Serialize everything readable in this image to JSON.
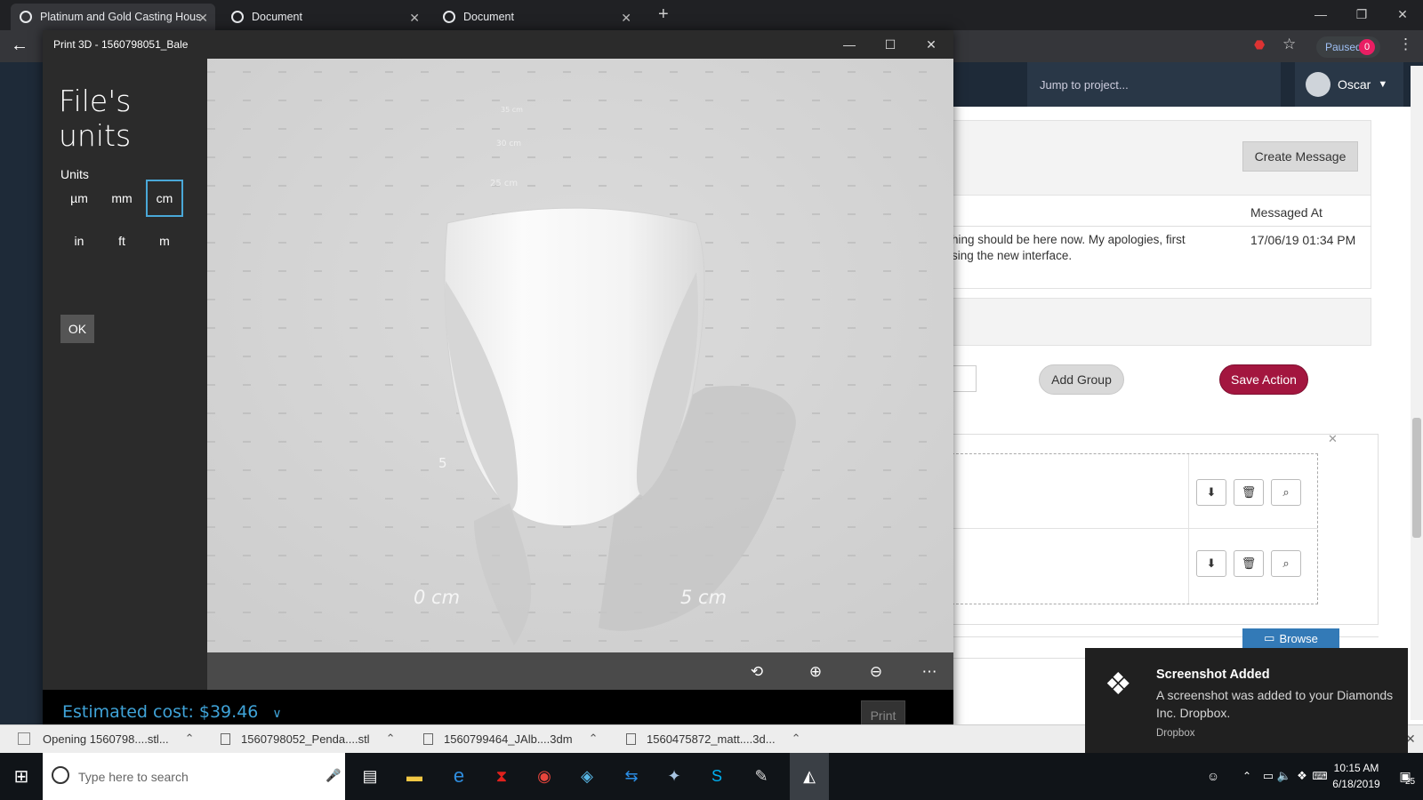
{
  "browser": {
    "tabs": [
      {
        "label": "Platinum and Gold Casting House",
        "active": true
      },
      {
        "label": "Document",
        "active": false
      },
      {
        "label": "Document",
        "active": false
      }
    ],
    "new_tab": "+",
    "paused_label": "Paused",
    "paused_count": "0"
  },
  "webpage": {
    "jump_placeholder": "Jump to project...",
    "user_name": "Oscar",
    "create_message": "Create Message",
    "messaged_at_header": "Messaged At",
    "message_text_line1": "hing should be here now. My apologies, first",
    "message_text_line2": "sing the new interface.",
    "message_time": "17/06/19 01:34 PM",
    "add_group": "Add Group",
    "save_action": "Save Action",
    "browse": "Browse"
  },
  "print3d": {
    "title": "Print 3D - 1560798051_Bale",
    "heading": "File's units",
    "units_label": "Units",
    "units": [
      "µm",
      "mm",
      "cm",
      "in",
      "ft",
      "m"
    ],
    "selected_unit": "cm",
    "ok": "OK",
    "ruler": {
      "vertical": [
        "35 cm",
        "30 cm",
        "25 cm"
      ],
      "side": "5",
      "bottom": [
        "0 cm",
        "5 cm"
      ]
    },
    "estimated_cost": "Estimated cost: $39.46",
    "print": "Print"
  },
  "downloads": [
    "Opening 1560798....stl...",
    "1560798052_Penda....stl",
    "1560799464_JAlb....3dm",
    "1560475872_matt....3d..."
  ],
  "toast": {
    "title": "Screenshot Added",
    "body": "A screenshot was added to your Diamonds Inc. Dropbox.",
    "source": "Dropbox"
  },
  "taskbar": {
    "search_placeholder": "Type here to search",
    "time": "10:15 AM",
    "date": "6/18/2019",
    "notif_count": "25"
  },
  "colors": {
    "accent_blue": "#3fa3d8",
    "save_red": "#a3163f",
    "browse_blue": "#337ab7"
  }
}
